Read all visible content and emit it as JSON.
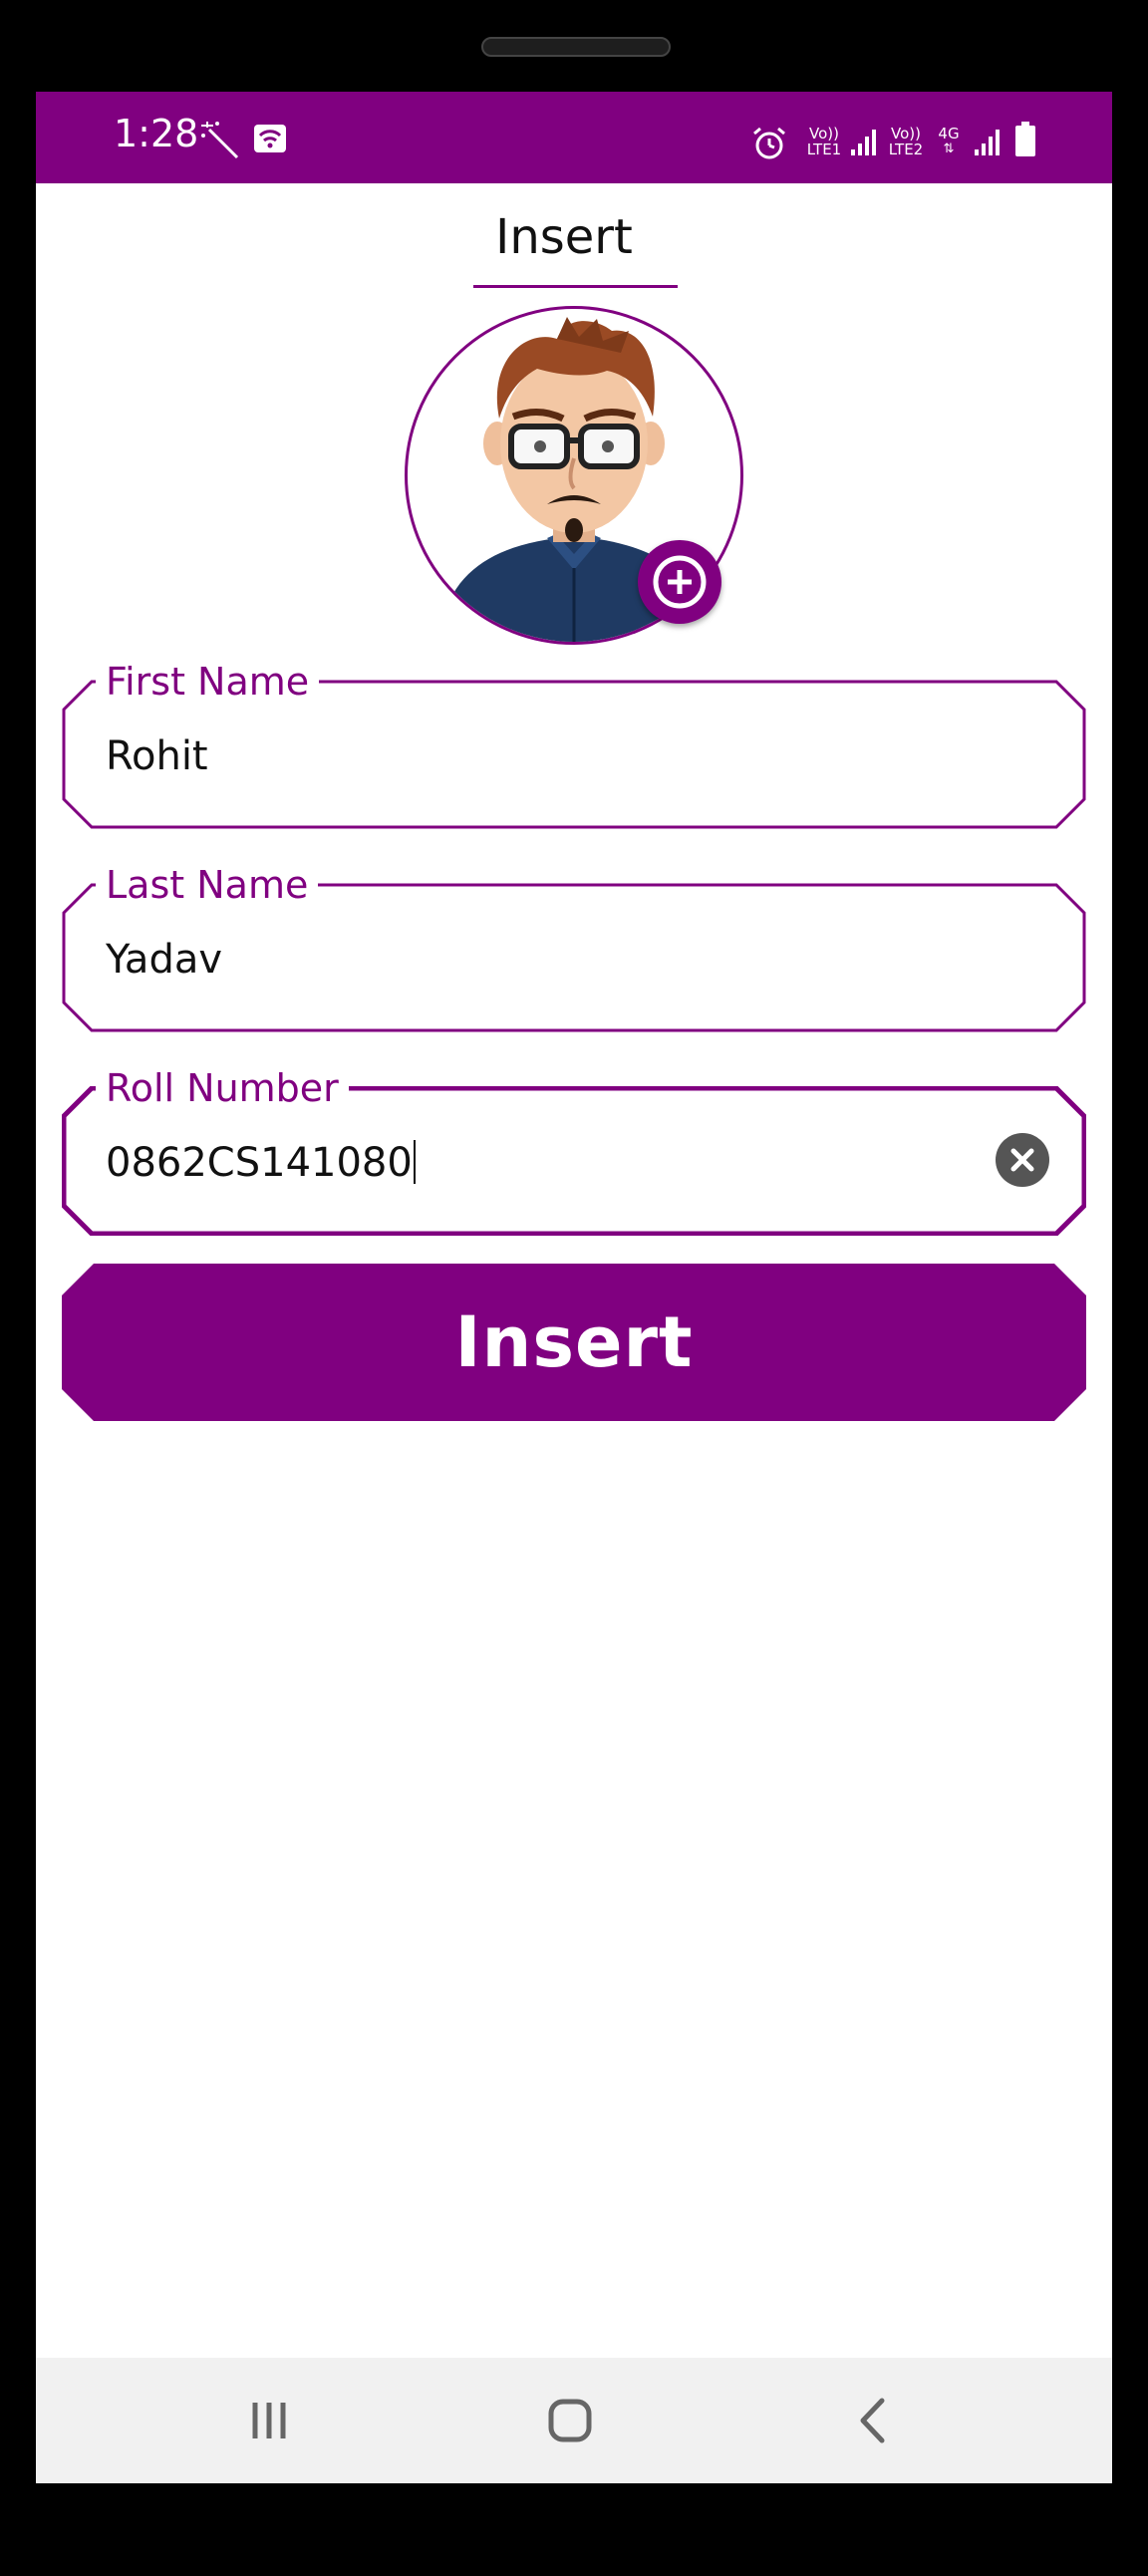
{
  "status_bar": {
    "time": "1:28",
    "sim1_top": "Vo))",
    "sim1_bottom": "LTE1",
    "sim2_top": "Vo))",
    "sim2_bottom": "LTE2",
    "network": "4G",
    "background_color": "#800080",
    "icons": [
      "magic-wand-icon",
      "cast-icon",
      "alarm-icon",
      "signal-icon",
      "signal-icon",
      "battery-icon"
    ]
  },
  "header": {
    "title": "Insert"
  },
  "avatar": {
    "add_icon": "plus-circle-icon"
  },
  "form": {
    "first_name": {
      "label": "First Name",
      "value": "Rohit"
    },
    "last_name": {
      "label": "Last Name",
      "value": "Yadav"
    },
    "roll_number": {
      "label": "Roll Number",
      "value": "0862CS141080",
      "clear_icon": "clear-icon"
    },
    "submit_label": "Insert"
  },
  "nav_bar": {
    "buttons": [
      "recent-apps-icon",
      "home-icon",
      "back-icon"
    ]
  },
  "colors": {
    "accent": "#800080",
    "text": "#111111",
    "nav_bg": "#f1f1f1"
  }
}
